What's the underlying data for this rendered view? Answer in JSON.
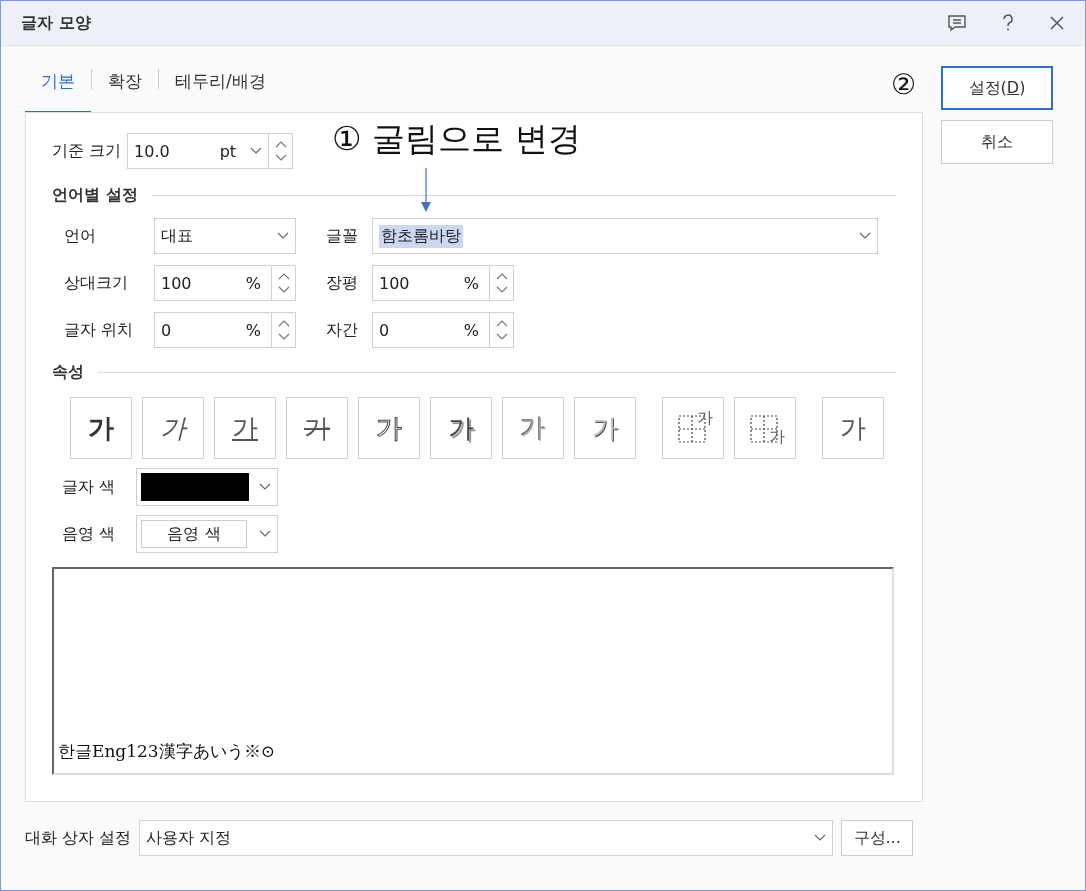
{
  "window": {
    "title": "글자 모양"
  },
  "tabs": [
    {
      "label": "기본",
      "selected": true
    },
    {
      "label": "확장",
      "selected": false
    },
    {
      "label": "테두리/배경",
      "selected": false
    }
  ],
  "annotations": [
    {
      "kind": "callout",
      "text": "① 굴림으로 변경"
    },
    {
      "kind": "marker",
      "text": "②"
    }
  ],
  "base_size": {
    "label": "기준 크기",
    "value": "10.0",
    "unit": "pt"
  },
  "language_settings": {
    "title": "언어별 설정",
    "language": {
      "label": "언어",
      "value": "대표"
    },
    "font": {
      "label": "글꼴",
      "value": "함초롬바탕",
      "highlighted": true
    },
    "spinners": [
      {
        "label": "상대크기",
        "value": "100",
        "unit": "%"
      },
      {
        "label": "장평",
        "value": "100",
        "unit": "%"
      },
      {
        "label": "글자 위치",
        "value": "0",
        "unit": "%"
      },
      {
        "label": "자간",
        "value": "0",
        "unit": "%"
      }
    ]
  },
  "attributes": {
    "title": "속성",
    "buttons": [
      {
        "kind": "bold",
        "glyph": "가"
      },
      {
        "kind": "italic",
        "glyph": "가"
      },
      {
        "kind": "underline",
        "glyph": "가"
      },
      {
        "kind": "strikethrough",
        "glyph": "가"
      },
      {
        "kind": "outline",
        "glyph": "가"
      },
      {
        "kind": "shadow",
        "glyph": "가"
      },
      {
        "kind": "emboss",
        "glyph": "가"
      },
      {
        "kind": "engrave",
        "glyph": "가"
      },
      {
        "kind": "superscript",
        "glyph": "가"
      },
      {
        "kind": "subscript",
        "glyph": "가"
      },
      {
        "kind": "normal",
        "glyph": "가"
      }
    ]
  },
  "text_color": {
    "label": "글자 색",
    "color": "#000000"
  },
  "shade_color": {
    "label": "음영 색",
    "value": "음영 색"
  },
  "preview": {
    "text": "한글Eng123漢字あいう※⊙"
  },
  "dialog_setting": {
    "label": "대화 상자 설정",
    "value": "사용자 지정",
    "button": "구성..."
  },
  "buttons": [
    {
      "before": "설정(",
      "mnemonic": "D",
      "after": ")",
      "default": true
    },
    {
      "before": "취소",
      "default": false
    }
  ]
}
